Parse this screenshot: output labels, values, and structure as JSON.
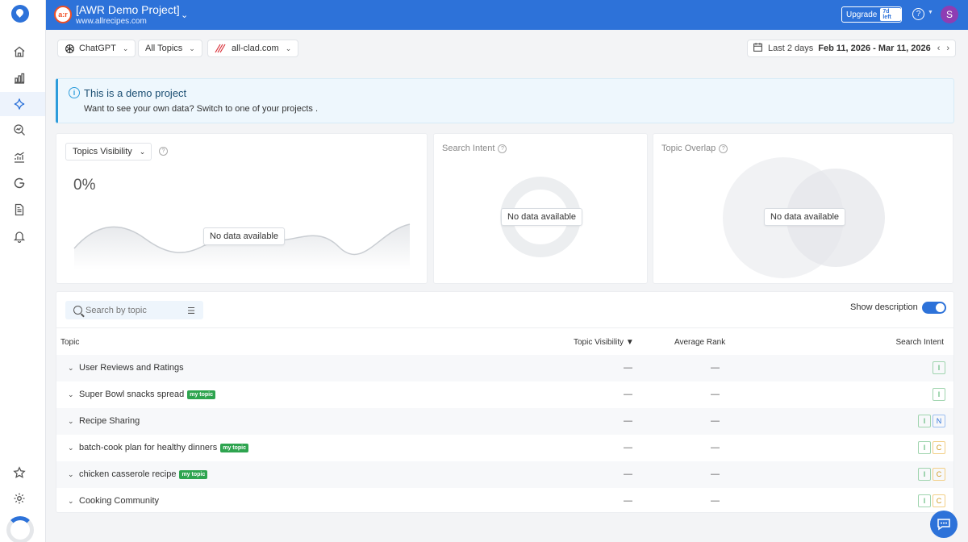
{
  "header": {
    "project_initials": "a:r",
    "project_name": "[AWR Demo Project]",
    "project_url": "www.allrecipes.com",
    "upgrade_label": "Upgrade",
    "upgrade_badge": "7d left",
    "help_label": "?",
    "user_initial": "S",
    "brand_color": "#2d72d9"
  },
  "sidebar": {
    "items": [
      "home-icon",
      "bar-chart-icon",
      "sparkle-icon",
      "search-analysis-icon",
      "analytics-icon",
      "google-icon",
      "document-icon",
      "bell-icon",
      "star-icon",
      "gear-icon"
    ]
  },
  "filters": {
    "engine": "ChatGPT",
    "topics": "All Topics",
    "domain": "all-clad.com",
    "date_label": "Last 2 days",
    "date_range": "Feb 11, 2026 - Mar 11, 2026"
  },
  "banner": {
    "title": "This is a demo project",
    "text": "Want to see your own data? Switch to one of your projects ."
  },
  "cards": {
    "visibility_select": "Topics Visibility",
    "visibility_value": "0%",
    "no_data": "No data available",
    "search_intent_title": "Search Intent",
    "topic_overlap_title": "Topic Overlap"
  },
  "table": {
    "search_placeholder": "Search by topic",
    "show_description": "Show description",
    "show_description_on": true,
    "columns": {
      "topic": "Topic",
      "visibility": "Topic Visibility",
      "rank": "Average Rank",
      "intent": "Search Intent"
    },
    "my_topic_label": "my topic",
    "rows": [
      {
        "name": "User Reviews and Ratings",
        "my_topic": false,
        "visibility": "—",
        "rank": "—",
        "intents": [
          "I"
        ]
      },
      {
        "name": "Super Bowl snacks spread",
        "my_topic": true,
        "visibility": "—",
        "rank": "—",
        "intents": [
          "I"
        ]
      },
      {
        "name": "Recipe Sharing",
        "my_topic": false,
        "visibility": "—",
        "rank": "—",
        "intents": [
          "I",
          "N"
        ]
      },
      {
        "name": "batch-cook plan for healthy dinners",
        "my_topic": true,
        "visibility": "—",
        "rank": "—",
        "intents": [
          "I",
          "C"
        ]
      },
      {
        "name": "chicken casserole recipe",
        "my_topic": true,
        "visibility": "—",
        "rank": "—",
        "intents": [
          "I",
          "C"
        ]
      },
      {
        "name": "Cooking Community",
        "my_topic": false,
        "visibility": "—",
        "rank": "—",
        "intents": [
          "I",
          "C"
        ]
      }
    ]
  }
}
